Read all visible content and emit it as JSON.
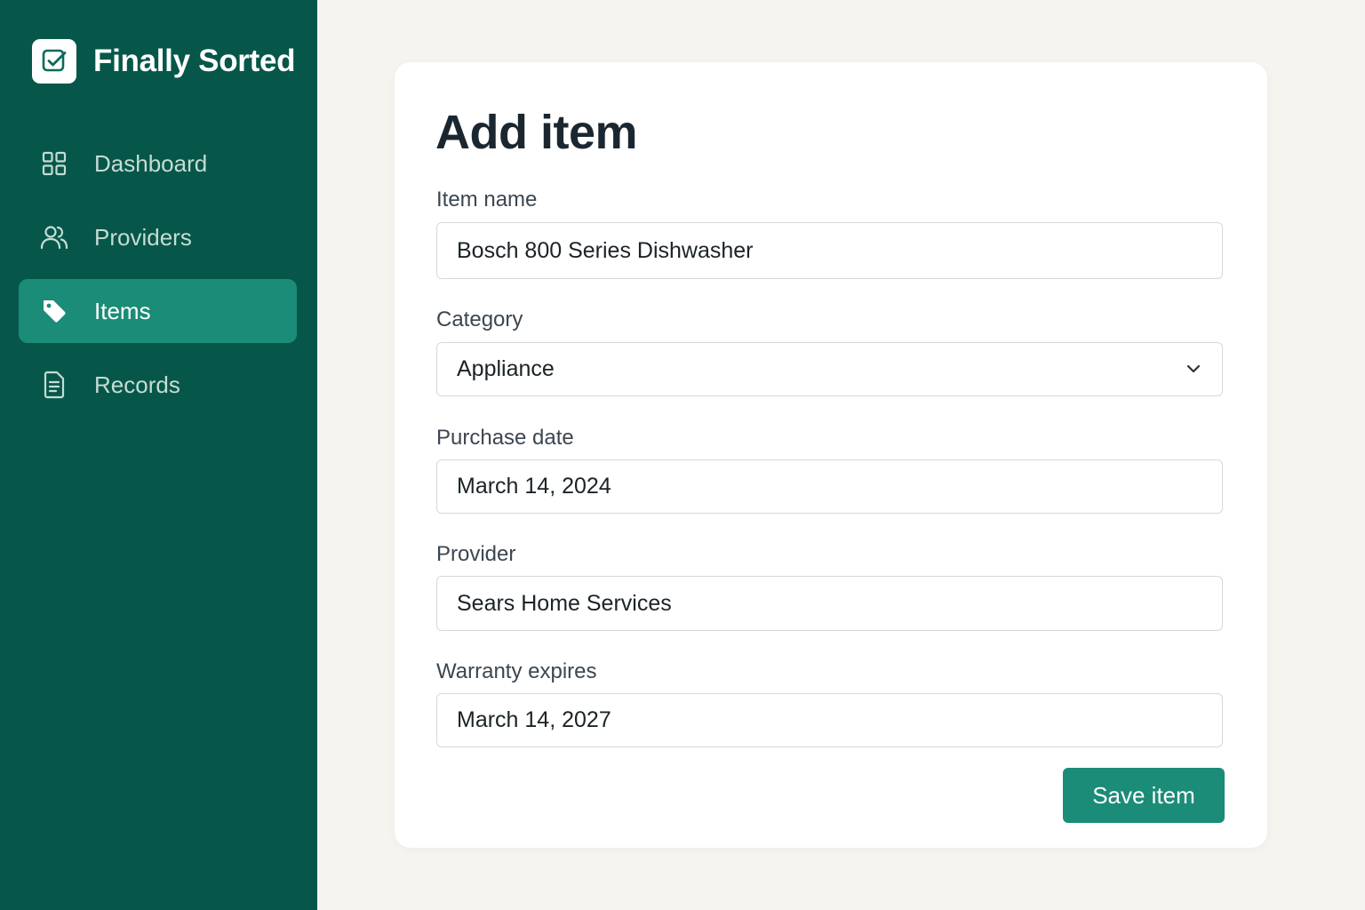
{
  "app": {
    "title": "Finally Sorted",
    "logo_icon": "checkbox-icon"
  },
  "sidebar": {
    "items": [
      {
        "label": "Dashboard",
        "icon": "grid-icon",
        "active": false
      },
      {
        "label": "Providers",
        "icon": "users-icon",
        "active": false
      },
      {
        "label": "Items",
        "icon": "tag-icon",
        "active": true
      },
      {
        "label": "Records",
        "icon": "document-icon",
        "active": false
      }
    ]
  },
  "form": {
    "title": "Add item",
    "fields": {
      "item_name": {
        "label": "Item name",
        "value": "Bosch 800 Series Dishwasher"
      },
      "category": {
        "label": "Category",
        "value": "Appliance"
      },
      "purchase_date": {
        "label": "Purchase date",
        "value": "March 14, 2024"
      },
      "provider": {
        "label": "Provider",
        "value": "Sears Home Services"
      },
      "warranty_expires": {
        "label": "Warranty expires",
        "value": "March 14, 2027"
      }
    },
    "save_label": "Save item"
  },
  "colors": {
    "sidebar_bg": "#06574a",
    "accent": "#1a8c78",
    "page_bg": "#f6f4ef"
  }
}
